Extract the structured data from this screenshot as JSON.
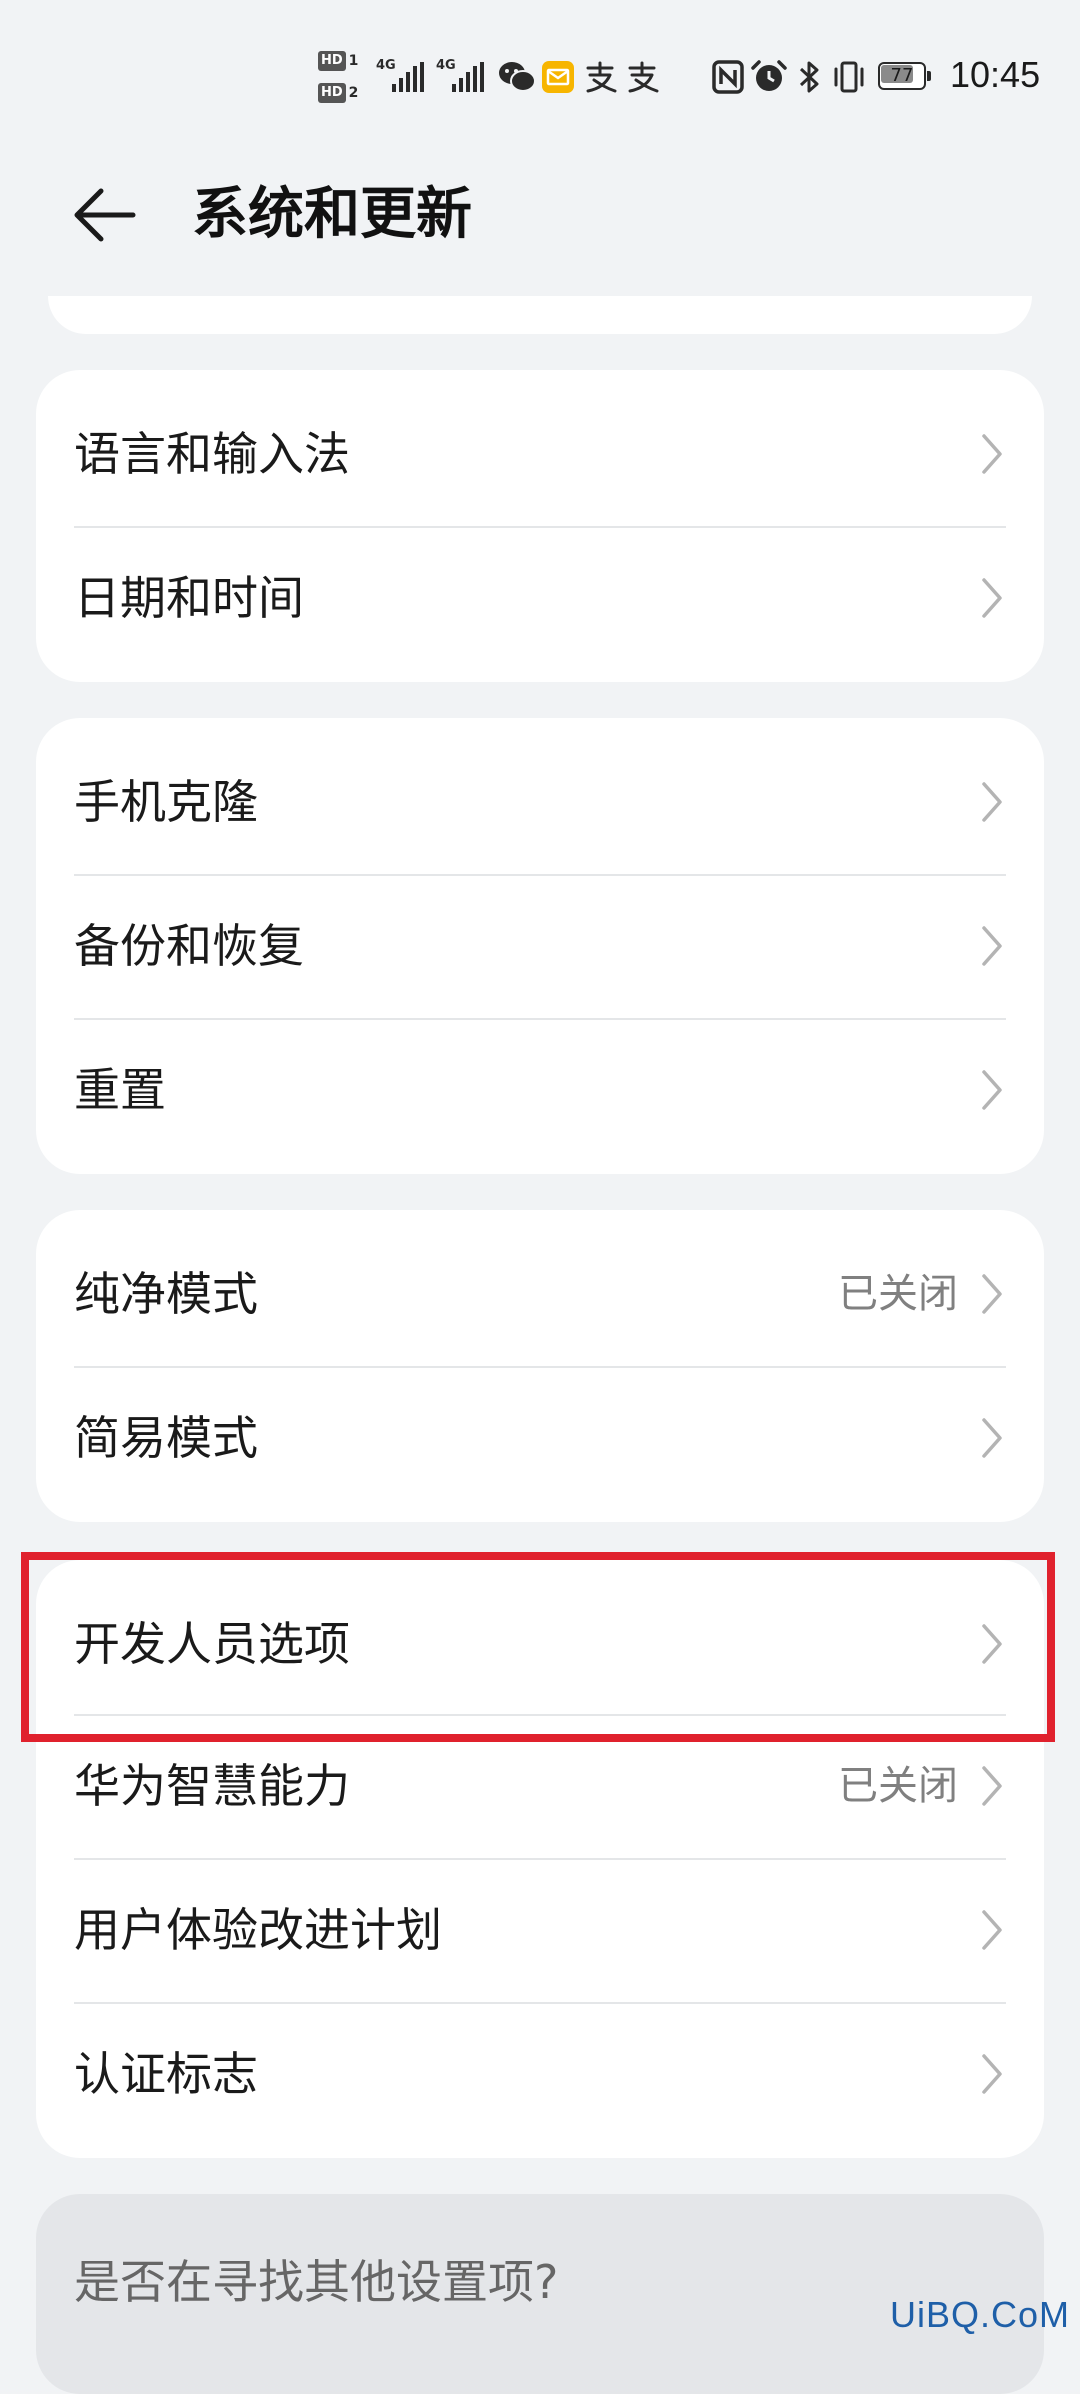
{
  "status_bar": {
    "hd1": "HD",
    "hd1_num": "1",
    "hd2": "HD",
    "hd2_num": "2",
    "net1": "4G",
    "net2": "4G",
    "battery": "77",
    "battery_level": 0.77,
    "time": "10:45",
    "icons": [
      "wechat-icon",
      "mail-icon",
      "alipay-icon",
      "alipay-icon",
      "nfc-icon",
      "alarm-icon",
      "bluetooth-icon",
      "vibrate-icon"
    ]
  },
  "header": {
    "title": "系统和更新"
  },
  "groups": [
    {
      "items": [
        {
          "label": "语言和输入法"
        },
        {
          "label": "日期和时间"
        }
      ]
    },
    {
      "items": [
        {
          "label": "手机克隆"
        },
        {
          "label": "备份和恢复"
        },
        {
          "label": "重置"
        }
      ]
    },
    {
      "items": [
        {
          "label": "纯净模式",
          "value": "已关闭"
        },
        {
          "label": "简易模式"
        }
      ]
    },
    {
      "items": [
        {
          "label": "开发人员选项"
        },
        {
          "label": "华为智慧能力",
          "value": "已关闭"
        },
        {
          "label": "用户体验改进计划"
        },
        {
          "label": "认证标志"
        }
      ]
    }
  ],
  "search_suggest": {
    "text": "是否在寻找其他设置项?"
  },
  "watermark": "UiBQ.CoM",
  "colors": {
    "background": "#f1f3f5",
    "card": "#ffffff",
    "highlight": "#e0212d",
    "secondary_text": "#808080"
  }
}
